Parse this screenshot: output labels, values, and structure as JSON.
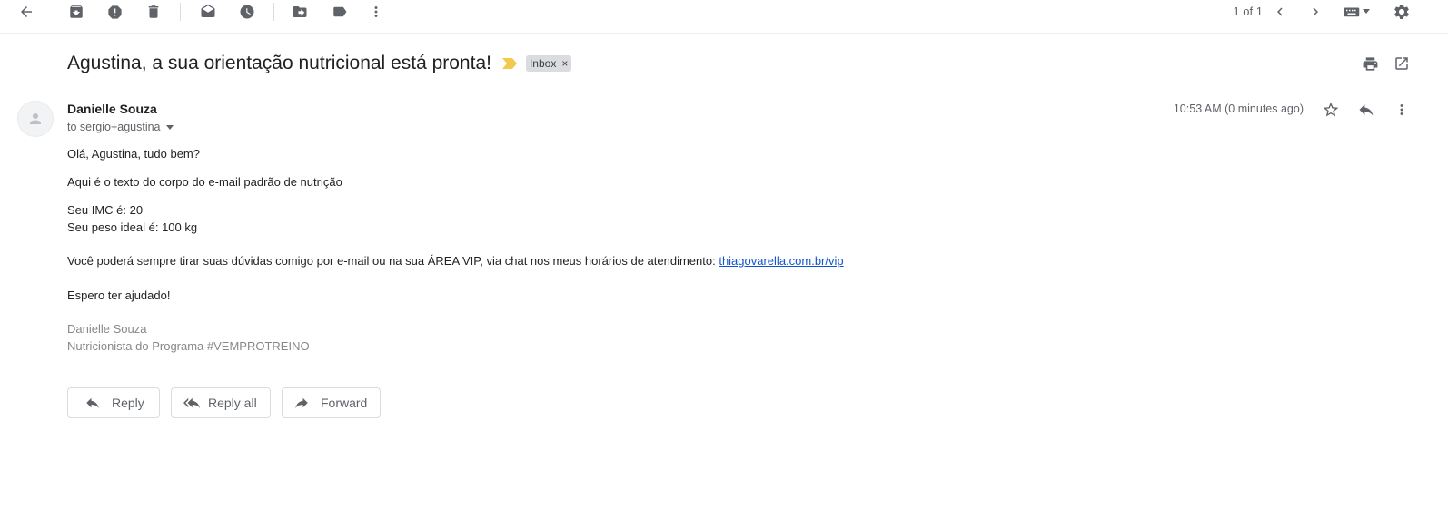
{
  "toolbar": {
    "back_icon": "arrow-left-icon",
    "archive_icon": "archive-icon",
    "spam_icon": "report-spam-icon",
    "delete_icon": "trash-icon",
    "mark_unread_icon": "mark-unread-icon",
    "snooze_icon": "clock-icon",
    "move_icon": "move-to-folder-icon",
    "label_icon": "label-icon",
    "more_icon": "more-vert-icon",
    "counter": "1 of 1",
    "input_tools_icon": "keyboard-icon",
    "settings_icon": "gear-icon"
  },
  "email": {
    "subject": "Agustina, a sua orientação nutricional está pronta!",
    "label": "Inbox",
    "label_remove": "×",
    "sender_name": "Danielle Souza",
    "to": "to sergio+agustina",
    "time": "10:53 AM (0 minutes ago)",
    "body": {
      "greeting": "Olá, Agustina, tudo bem?",
      "line1": "Aqui é o texto do corpo do e-mail padrão de nutrição",
      "imc": "Seu IMC é: 20",
      "weight": "Seu peso ideal é: 100 kg",
      "contact_text": "Você poderá sempre tirar suas dúvidas comigo por e-mail ou na sua ÁREA VIP, via chat nos meus horários de atendimento: ",
      "contact_link": "thiagovarella.com.br/vip",
      "closing": "Espero ter ajudado!",
      "signature_name": "Danielle Souza",
      "signature_title": "Nutricionista do Programa #VEMPROTREINO"
    }
  },
  "actions": {
    "reply": "Reply",
    "reply_all": "Reply all",
    "forward": "Forward"
  },
  "colors": {
    "icon_gray": "#5f6368",
    "importance_yellow": "#f2c94c",
    "link_blue": "#1155cc"
  }
}
